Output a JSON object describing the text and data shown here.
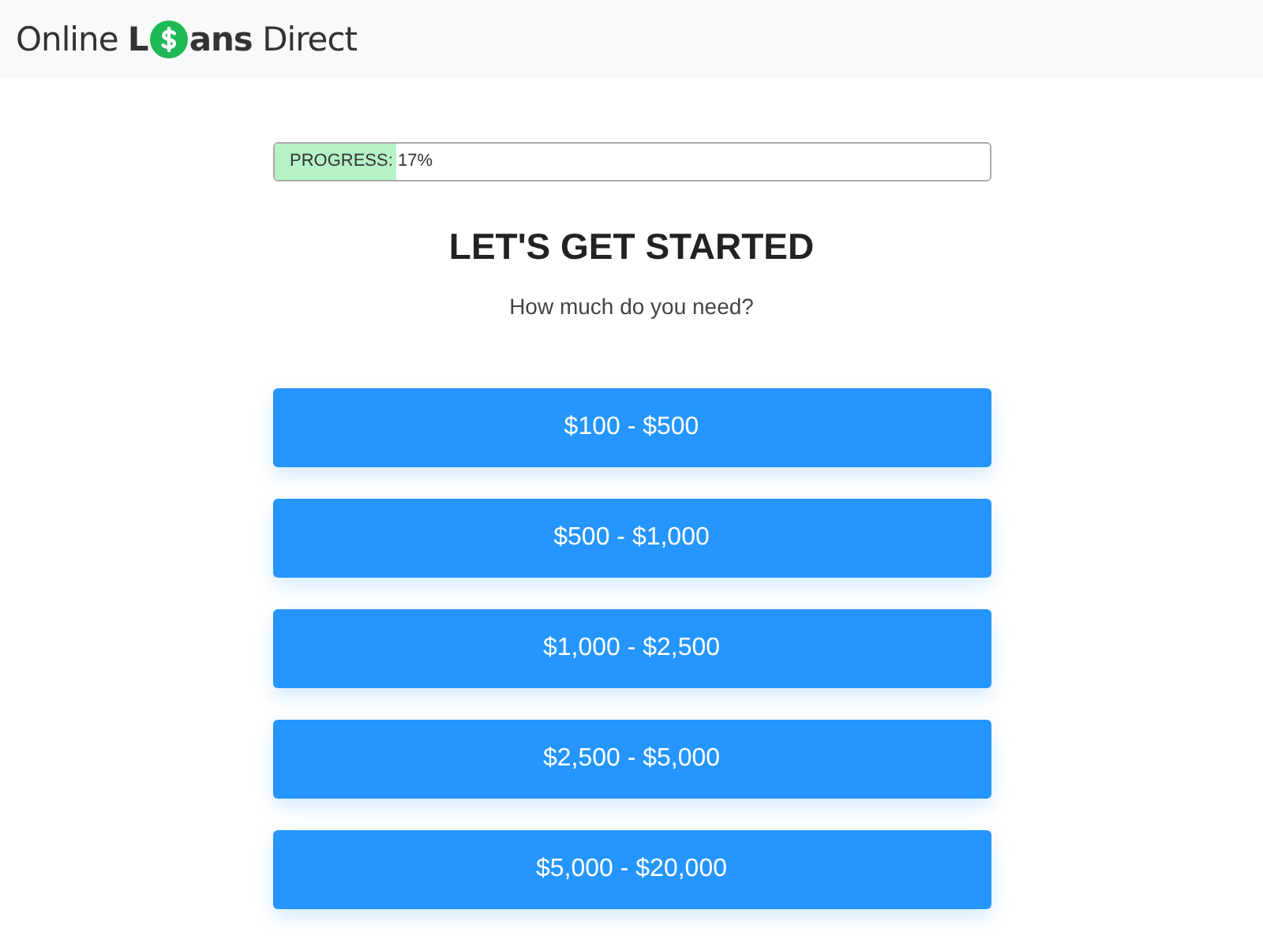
{
  "logo": {
    "before": "Online **L**",
    "after": "**ans** Direct"
  },
  "progress": {
    "label": "PROGRESS: 17%",
    "level": 0.17
  },
  "heading": "LET'S GET STARTED",
  "question": "How much do you need?",
  "options": [
    "$100 - $500",
    "$500 - $1,000",
    "$1,000 - $2,500",
    "$2,500 - $5,000",
    "$5,000 - $20,000"
  ]
}
